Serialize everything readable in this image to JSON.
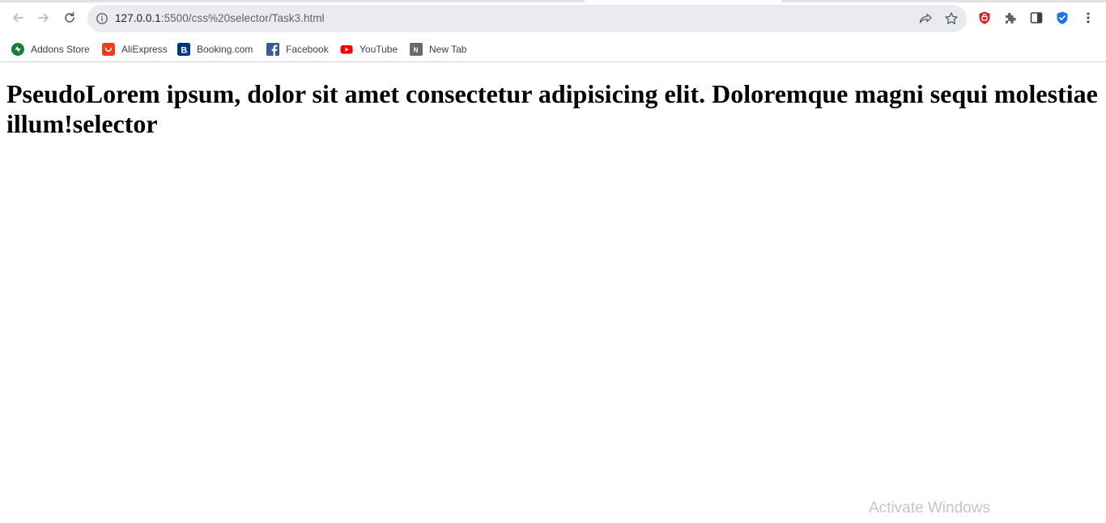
{
  "browser": {
    "url_host": "127.0.0.1",
    "url_path": ":5500/css%20selector/Task3.html",
    "nav_icons": [
      "back-icon",
      "forward-icon",
      "reload-icon"
    ],
    "omnibox_icons": [
      "site-info-icon",
      "share-icon",
      "bookmark-star-icon"
    ],
    "extension_icons": [
      "adblock-shield-icon",
      "extensions-puzzle-icon",
      "side-panel-icon",
      "password-shield-icon",
      "menu-dots-icon"
    ]
  },
  "bookmarks": [
    {
      "label": "Addons Store",
      "icon": "addons-store-icon",
      "color": "#1a7f3c"
    },
    {
      "label": "AliExpress",
      "icon": "aliexpress-icon",
      "color": "#e8401a"
    },
    {
      "label": "Booking.com",
      "icon": "booking-icon",
      "color": "#003580"
    },
    {
      "label": "Facebook",
      "icon": "facebook-icon",
      "color": "#3b5998"
    },
    {
      "label": "YouTube",
      "icon": "youtube-icon",
      "color": "#ff0000"
    },
    {
      "label": "New Tab",
      "icon": "new-tab-icon",
      "color": "#6b6b6b"
    }
  ],
  "page": {
    "heading": "PseudoLorem ipsum, dolor sit amet consectetur adipisicing elit. Doloremque magni sequi molestiae illum!selector"
  },
  "watermark": "Activate Windows"
}
